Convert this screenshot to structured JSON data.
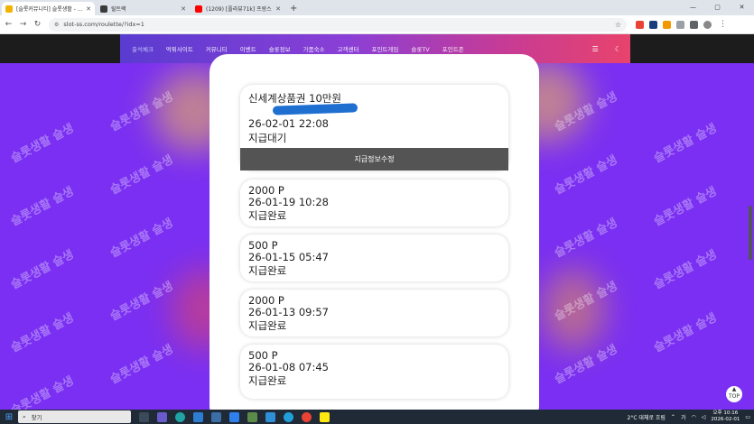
{
  "browser": {
    "tabs": [
      {
        "title": "[슬롯커뮤니티] 슬롯생활 - 온라",
        "active": true,
        "color": "#f0b400"
      },
      {
        "title": "릴트랙",
        "active": false,
        "color": "#3a3a3a"
      },
      {
        "title": "(1209) [플라뷰71k] 프랑스",
        "active": false,
        "color": "#ff0000"
      }
    ],
    "url": "slot-ss.com/roulette/?idx=1",
    "back_icon": "←",
    "forward_icon": "→",
    "reload_icon": "↻",
    "new_tab_icon": "+",
    "window_controls": [
      "—",
      "▢",
      "✕"
    ]
  },
  "site": {
    "nav_items": [
      "출석체크",
      "먹튀사이트",
      "커뮤니티",
      "이벤트",
      "슬롯정보",
      "가품숙소",
      "고객센터",
      "포인트게임",
      "슬롯TV",
      "포인트존"
    ],
    "watermark": "슬롯생활 슬생"
  },
  "rewards": [
    {
      "title": "신세계상품권 10만원",
      "date": "26-02-01 22:08",
      "status": "지급대기",
      "action": "지급정보수정"
    },
    {
      "title": "2000 P",
      "date": "26-01-19 10:28",
      "status": "지급완료"
    },
    {
      "title": "500 P",
      "date": "26-01-15 05:47",
      "status": "지급완료"
    },
    {
      "title": "2000 P",
      "date": "26-01-13 09:57",
      "status": "지급완료"
    },
    {
      "title": "500 P",
      "date": "26-01-08 07:45",
      "status": "지급완료"
    }
  ],
  "taskbar": {
    "search_label": "찾기",
    "weather": "2°C  대체로 흐림",
    "time": "오후 10:16",
    "date": "2026-02-01",
    "lang": "가"
  }
}
